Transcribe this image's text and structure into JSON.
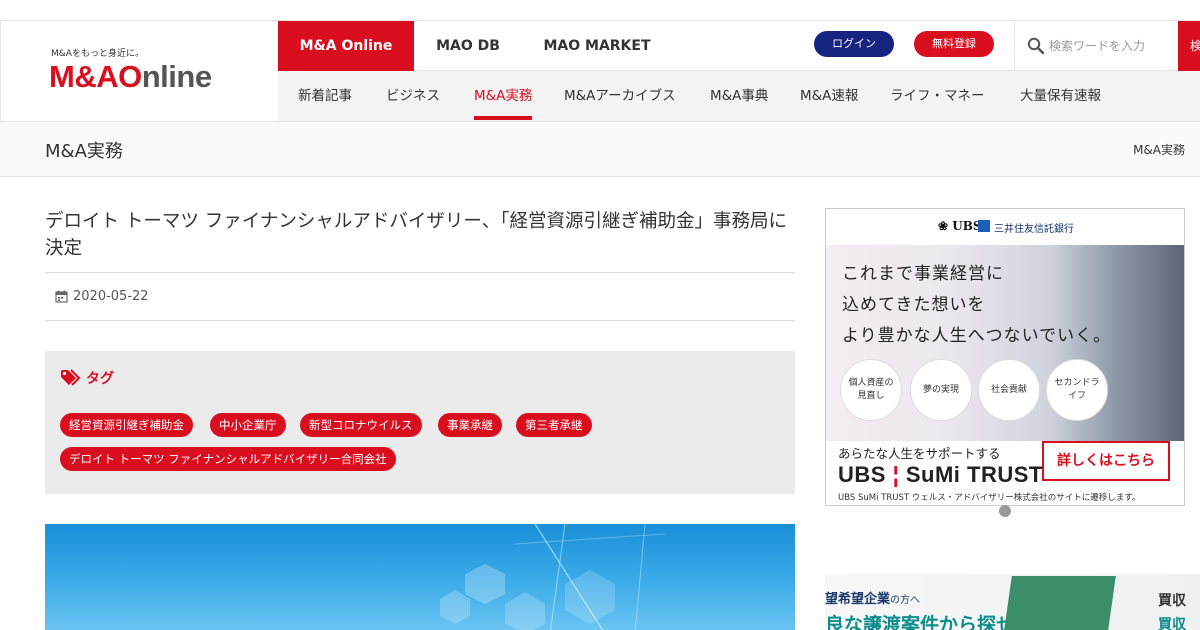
{
  "brand": {
    "tagline": "M&Aをもっと身近に。",
    "logo_part1": "M&A",
    "logo_part2": "Online",
    "accent_color": "#d90f1f"
  },
  "primary_nav": {
    "items": [
      {
        "label": "M&A Online",
        "active": true
      },
      {
        "label": "MAO DB",
        "active": false
      },
      {
        "label": "MAO MARKET",
        "active": false
      }
    ],
    "login_label": "ログイン",
    "register_label": "無料登録",
    "search_placeholder": "検索ワードを入力",
    "search_button_label": "検索"
  },
  "secondary_nav": {
    "items": [
      {
        "label": "新着記事",
        "active": false
      },
      {
        "label": "ビジネス",
        "active": false
      },
      {
        "label": "M&A実務",
        "active": true
      },
      {
        "label": "M&Aアーカイブス",
        "active": false
      },
      {
        "label": "M&A事典",
        "active": false
      },
      {
        "label": "M&A速報",
        "active": false
      },
      {
        "label": "ライフ・マネー",
        "active": false
      },
      {
        "label": "大量保有速報",
        "active": false
      }
    ]
  },
  "page": {
    "section_title": "M&A実務",
    "breadcrumb": "M&A実務"
  },
  "article": {
    "title": "デロイト トーマツ ファイナンシャルアドバイザリー、「経営資源引継ぎ補助金」事務局に決定",
    "date": "2020-05-22",
    "tags_heading": "タグ",
    "tags": [
      "経営資源引継ぎ補助金",
      "中小企業庁",
      "新型コロナウイルス",
      "事業承継",
      "第三者承継",
      "デロイト トーマツ ファイナンシャルアドバイザリー合同会社"
    ]
  },
  "sidebar_ad": {
    "logo_ubs": "UBS",
    "logo_bank": "三井住友信託銀行",
    "copy_lines": [
      "これまで事業経営に",
      "込めてきた想いを",
      "より豊かな人生へつないでいく。"
    ],
    "circles": [
      "個人資産の見直し",
      "夢の実現",
      "社会貢献",
      "セカンドライフ"
    ],
    "subline": "あらたな人生をサポートする",
    "brand_left": "UBS",
    "brand_right": "SuMi TRUST",
    "cta_label": "詳しくはこちら",
    "note": "UBS SuMi TRUST ウェルス・アドバイザリー株式会社のサイトに遷移します。"
  },
  "sidebar_ad2": {
    "line1_main": "望希望企業",
    "line1_small": "の方へ",
    "line2": "良な譲渡案件から探せます",
    "right1": "買収",
    "right2": "買収"
  }
}
